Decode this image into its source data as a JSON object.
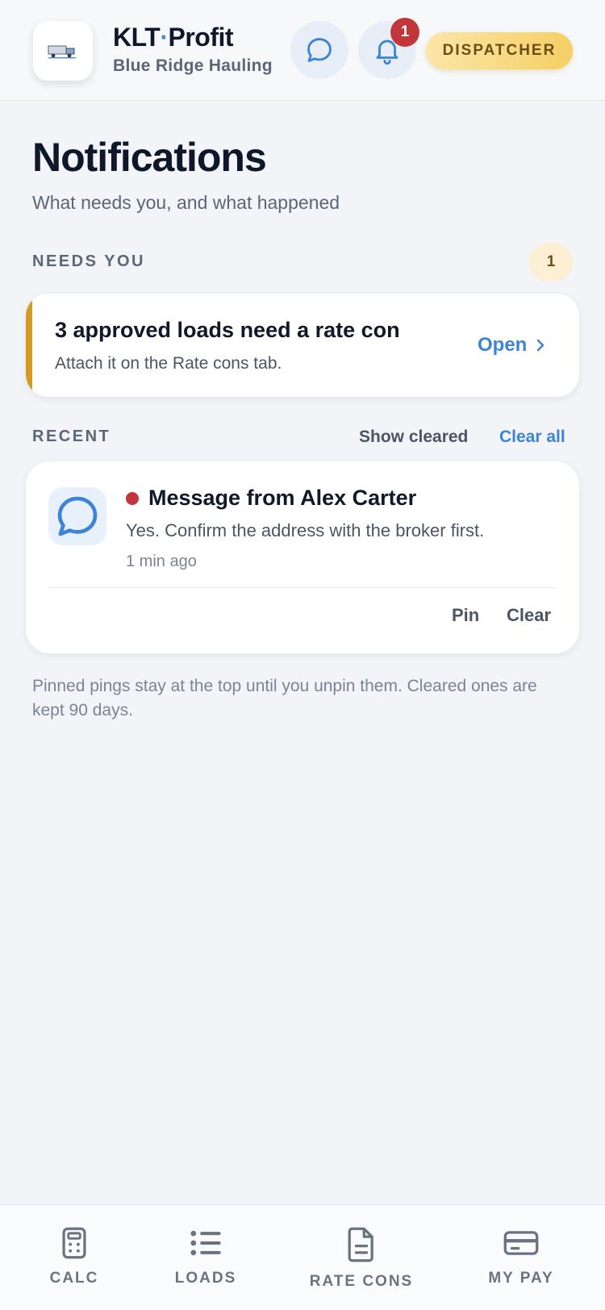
{
  "header": {
    "app_name_part1": "KLT",
    "app_name_dot": "·",
    "app_name_part2": "Profit",
    "company": "Blue Ridge Hauling",
    "notification_count": "1",
    "role": "DISPATCHER"
  },
  "page": {
    "title": "Notifications",
    "subtitle": "What needs you, and what happened"
  },
  "needs_you": {
    "label": "NEEDS YOU",
    "count": "1",
    "card": {
      "title": "3 approved loads need a rate con",
      "subtitle": "Attach it on the Rate cons tab.",
      "action": "Open"
    }
  },
  "recent": {
    "label": "RECENT",
    "show_cleared": "Show cleared",
    "clear_all": "Clear all",
    "items": [
      {
        "title": "Message from Alex Carter",
        "body": "Yes. Confirm the address with the broker first.",
        "time": "1 min ago",
        "pin": "Pin",
        "clear": "Clear"
      }
    ]
  },
  "footnote": "Pinned pings stay at the top until you unpin them. Cleared ones are kept 90 days.",
  "bottom_nav": {
    "items": [
      {
        "label": "CALC",
        "icon": "calculator-icon"
      },
      {
        "label": "LOADS",
        "icon": "list-icon"
      },
      {
        "label": "RATE CONS",
        "icon": "document-icon"
      },
      {
        "label": "MY PAY",
        "icon": "credit-card-icon"
      }
    ]
  },
  "colors": {
    "accent": "#3d84d8",
    "badge": "#c0363b",
    "warning": "#d49a25"
  }
}
